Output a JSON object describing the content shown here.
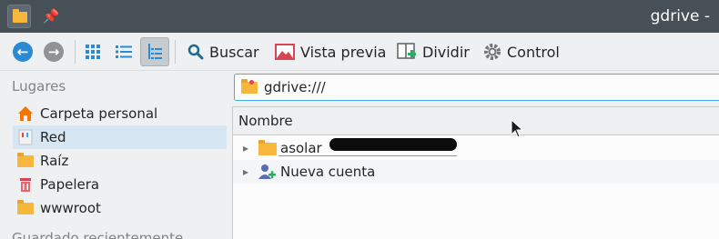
{
  "window": {
    "title": "gdrive -"
  },
  "toolbar": {
    "search_label": "Buscar",
    "preview_label": "Vista previa",
    "split_label": "Dividir",
    "control_label": "Control"
  },
  "sidebar": {
    "section_places": "Lugares",
    "section_recent": "Guardado recientemente",
    "items": [
      {
        "label": "Carpeta personal",
        "icon": "home-icon"
      },
      {
        "label": "Red",
        "icon": "network-icon",
        "selected": true
      },
      {
        "label": "Raíz",
        "icon": "folder-icon"
      },
      {
        "label": "Papelera",
        "icon": "trash-icon"
      },
      {
        "label": "wwwroot",
        "icon": "folder-icon"
      }
    ]
  },
  "location": {
    "path": "gdrive:///"
  },
  "filelist": {
    "column_name": "Nombre",
    "rows": [
      {
        "label": "asolar",
        "icon": "folder-icon"
      },
      {
        "label": "Nueva cuenta",
        "icon": "add-user-icon"
      }
    ]
  },
  "colors": {
    "accent": "#3daee9",
    "titlebar": "#475057",
    "folder": "#f6b73c",
    "selection": "#d6e6f2"
  }
}
